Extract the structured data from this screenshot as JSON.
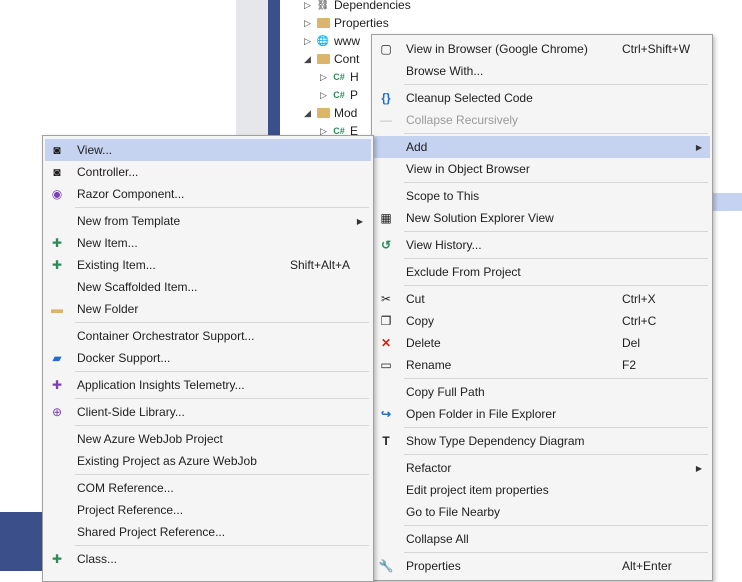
{
  "tree": {
    "items": [
      {
        "label": "Dependencies"
      },
      {
        "label": "Properties"
      },
      {
        "label": "www"
      },
      {
        "label": "Cont"
      },
      {
        "label": "H"
      },
      {
        "label": "P"
      },
      {
        "label": "Mod"
      },
      {
        "label": "E"
      }
    ],
    "cs_label": "C#"
  },
  "right_menu": {
    "items": [
      {
        "label": "View in Browser (Google Chrome)",
        "shortcut": "Ctrl+Shift+W"
      },
      {
        "label": "Browse With..."
      },
      {
        "label": "Cleanup Selected Code"
      },
      {
        "label": "Collapse Recursively"
      },
      {
        "label": "Add"
      },
      {
        "label": "View in Object Browser"
      },
      {
        "label": "Scope to This"
      },
      {
        "label": "New Solution Explorer View"
      },
      {
        "label": "View History..."
      },
      {
        "label": "Exclude From Project"
      },
      {
        "label": "Cut",
        "shortcut": "Ctrl+X"
      },
      {
        "label": "Copy",
        "shortcut": "Ctrl+C"
      },
      {
        "label": "Delete",
        "shortcut": "Del"
      },
      {
        "label": "Rename",
        "shortcut": "F2"
      },
      {
        "label": "Copy Full Path"
      },
      {
        "label": "Open Folder in File Explorer"
      },
      {
        "label": "Show Type Dependency Diagram"
      },
      {
        "label": "Refactor"
      },
      {
        "label": "Edit project item properties"
      },
      {
        "label": "Go to File Nearby"
      },
      {
        "label": "Collapse All"
      },
      {
        "label": "Properties",
        "shortcut": "Alt+Enter"
      }
    ]
  },
  "left_menu": {
    "items": [
      {
        "label": "View..."
      },
      {
        "label": "Controller..."
      },
      {
        "label": "Razor Component..."
      },
      {
        "label": "New from Template"
      },
      {
        "label": "New Item..."
      },
      {
        "label": "Existing Item...",
        "shortcut": "Shift+Alt+A"
      },
      {
        "label": "New Scaffolded Item..."
      },
      {
        "label": "New Folder"
      },
      {
        "label": "Container Orchestrator Support..."
      },
      {
        "label": "Docker Support..."
      },
      {
        "label": "Application Insights Telemetry..."
      },
      {
        "label": "Client-Side Library..."
      },
      {
        "label": "New Azure WebJob Project"
      },
      {
        "label": "Existing Project as Azure WebJob"
      },
      {
        "label": "COM Reference..."
      },
      {
        "label": "Project Reference..."
      },
      {
        "label": "Shared Project Reference..."
      },
      {
        "label": "Class..."
      }
    ]
  },
  "icons": {
    "browser": "▢",
    "cleanup": "{}",
    "collapse": "—",
    "history": "↺",
    "scope_view": "▦",
    "cut": "✂",
    "copy": "❐",
    "delete": "✕",
    "rename": "▭",
    "open_folder": "↪",
    "type_diagram": "T",
    "wrench": "🔧",
    "sub_arrow": "▶",
    "view": "◙",
    "controller": "◙",
    "razor": "◉",
    "new_item": "✚",
    "existing_item": "✚",
    "folder": "▬",
    "docker": "▰",
    "insights": "✚",
    "library": "⊕",
    "class": "✚"
  },
  "colors": {
    "menu_bg": "#f5f5f5",
    "highlight": "#c5d2f0",
    "accent_blue": "#3b4f8a",
    "delete_red": "#c42b1c",
    "cleanup_blue": "#1e6fc9",
    "razor_purple": "#7b3fb8",
    "history_green": "#2e8b57",
    "folder_yellow": "#dcb46a"
  }
}
